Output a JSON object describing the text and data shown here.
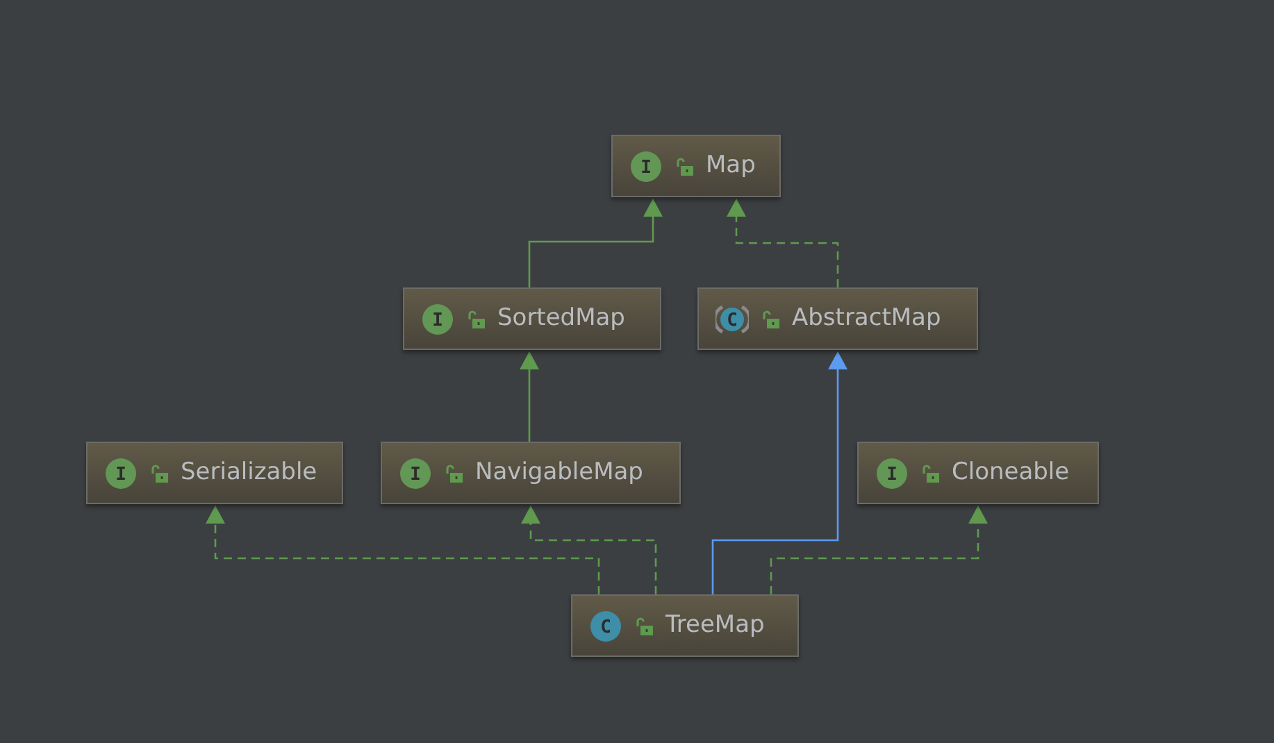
{
  "diagram": {
    "nodes": [
      {
        "name": "Map",
        "kind": "interface",
        "badge": "I"
      },
      {
        "name": "SortedMap",
        "kind": "interface",
        "badge": "I"
      },
      {
        "name": "AbstractMap",
        "kind": "abstract_class",
        "badge": "C"
      },
      {
        "name": "Serializable",
        "kind": "interface",
        "badge": "I"
      },
      {
        "name": "NavigableMap",
        "kind": "interface",
        "badge": "I"
      },
      {
        "name": "Cloneable",
        "kind": "interface",
        "badge": "I"
      },
      {
        "name": "TreeMap",
        "kind": "class",
        "badge": "C"
      }
    ],
    "edges": [
      {
        "kind": "interface_extends"
      },
      {
        "kind": "implements"
      },
      {
        "kind": "interface_extends"
      },
      {
        "kind": "class_extends"
      },
      {
        "kind": "implements"
      },
      {
        "kind": "implements"
      },
      {
        "kind": "implements"
      }
    ]
  }
}
